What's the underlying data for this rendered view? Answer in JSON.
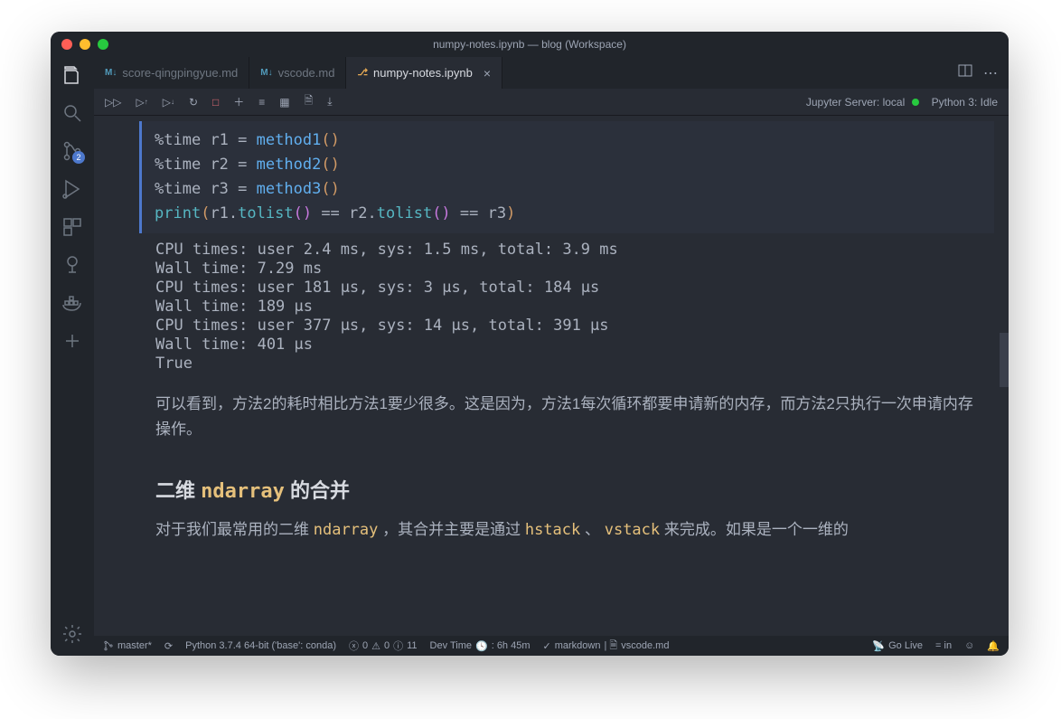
{
  "window": {
    "title": "numpy-notes.ipynb — blog (Workspace)"
  },
  "tabs": [
    {
      "icon": "M↓",
      "label": "score-qingpingyue.md"
    },
    {
      "icon": "M↓",
      "label": "vscode.md"
    },
    {
      "icon": "{}",
      "label": "numpy-notes.ipynb",
      "active": true
    }
  ],
  "scm_badge": "2",
  "toolbar": {
    "jupyter_label": "Jupyter Server: local",
    "kernel_label": "Python 3: Idle"
  },
  "code": {
    "l1_magic": "%time",
    "l1_var": "r1",
    "l1_fn": "method1",
    "l2_magic": "%time",
    "l2_var": "r2",
    "l2_fn": "method2",
    "l3_magic": "%time",
    "l3_var": "r3",
    "l3_fn": "method3",
    "l4_print": "print",
    "l4_a": "r1",
    "l4_m": "tolist",
    "l4_b": "r2",
    "l4_c": "r3"
  },
  "output": "CPU times: user 2.4 ms, sys: 1.5 ms, total: 3.9 ms\nWall time: 7.29 ms\nCPU times: user 181 µs, sys: 3 µs, total: 184 µs\nWall time: 189 µs\nCPU times: user 377 µs, sys: 14 µs, total: 391 µs\nWall time: 401 µs\nTrue",
  "md": {
    "p1": "可以看到，方法2的耗时相比方法1要少很多。这是因为，方法1每次循环都要申请新的内存，而方法2只执行一次申请内存操作。",
    "h_pre": "二维 ",
    "h_code": "ndarray",
    "h_post": " 的合并",
    "p2_a": "对于我们最常用的二维 ",
    "p2_code1": "ndarray",
    "p2_b": " ，其合并主要是通过 ",
    "p2_code2": "hstack",
    "p2_c": " 、 ",
    "p2_code3": "vstack",
    "p2_d": " 来完成。如果是一个一维的"
  },
  "status": {
    "branch": "master*",
    "python": "Python 3.7.4 64-bit ('base': conda)",
    "err": "0",
    "warn": "0",
    "info": "11",
    "devtime": "Dev Time",
    "devtime_v": ": 6h 45m",
    "lang": "markdown",
    "file": "vscode.md",
    "golive": "Go Live",
    "eq": "= in"
  }
}
